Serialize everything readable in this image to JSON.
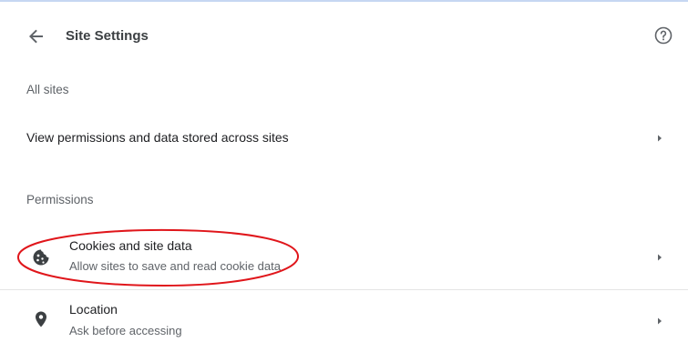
{
  "header": {
    "back_icon": "arrow-left-icon",
    "title": "Site Settings",
    "help_icon": "help-circle-icon"
  },
  "all_sites": {
    "section_label": "All sites",
    "row_label": "View permissions and data stored across sites",
    "chevron_icon": "chevron-right-icon"
  },
  "permissions": {
    "section_label": "Permissions",
    "items": [
      {
        "icon": "cookie-icon",
        "title": "Cookies and site data",
        "subtitle": "Allow sites to save and read cookie data"
      },
      {
        "icon": "location-pin-icon",
        "title": "Location",
        "subtitle": "Ask before accessing"
      }
    ]
  },
  "colors": {
    "annotation_circle": "#e0161b",
    "top_border": "#c6d7f2"
  }
}
